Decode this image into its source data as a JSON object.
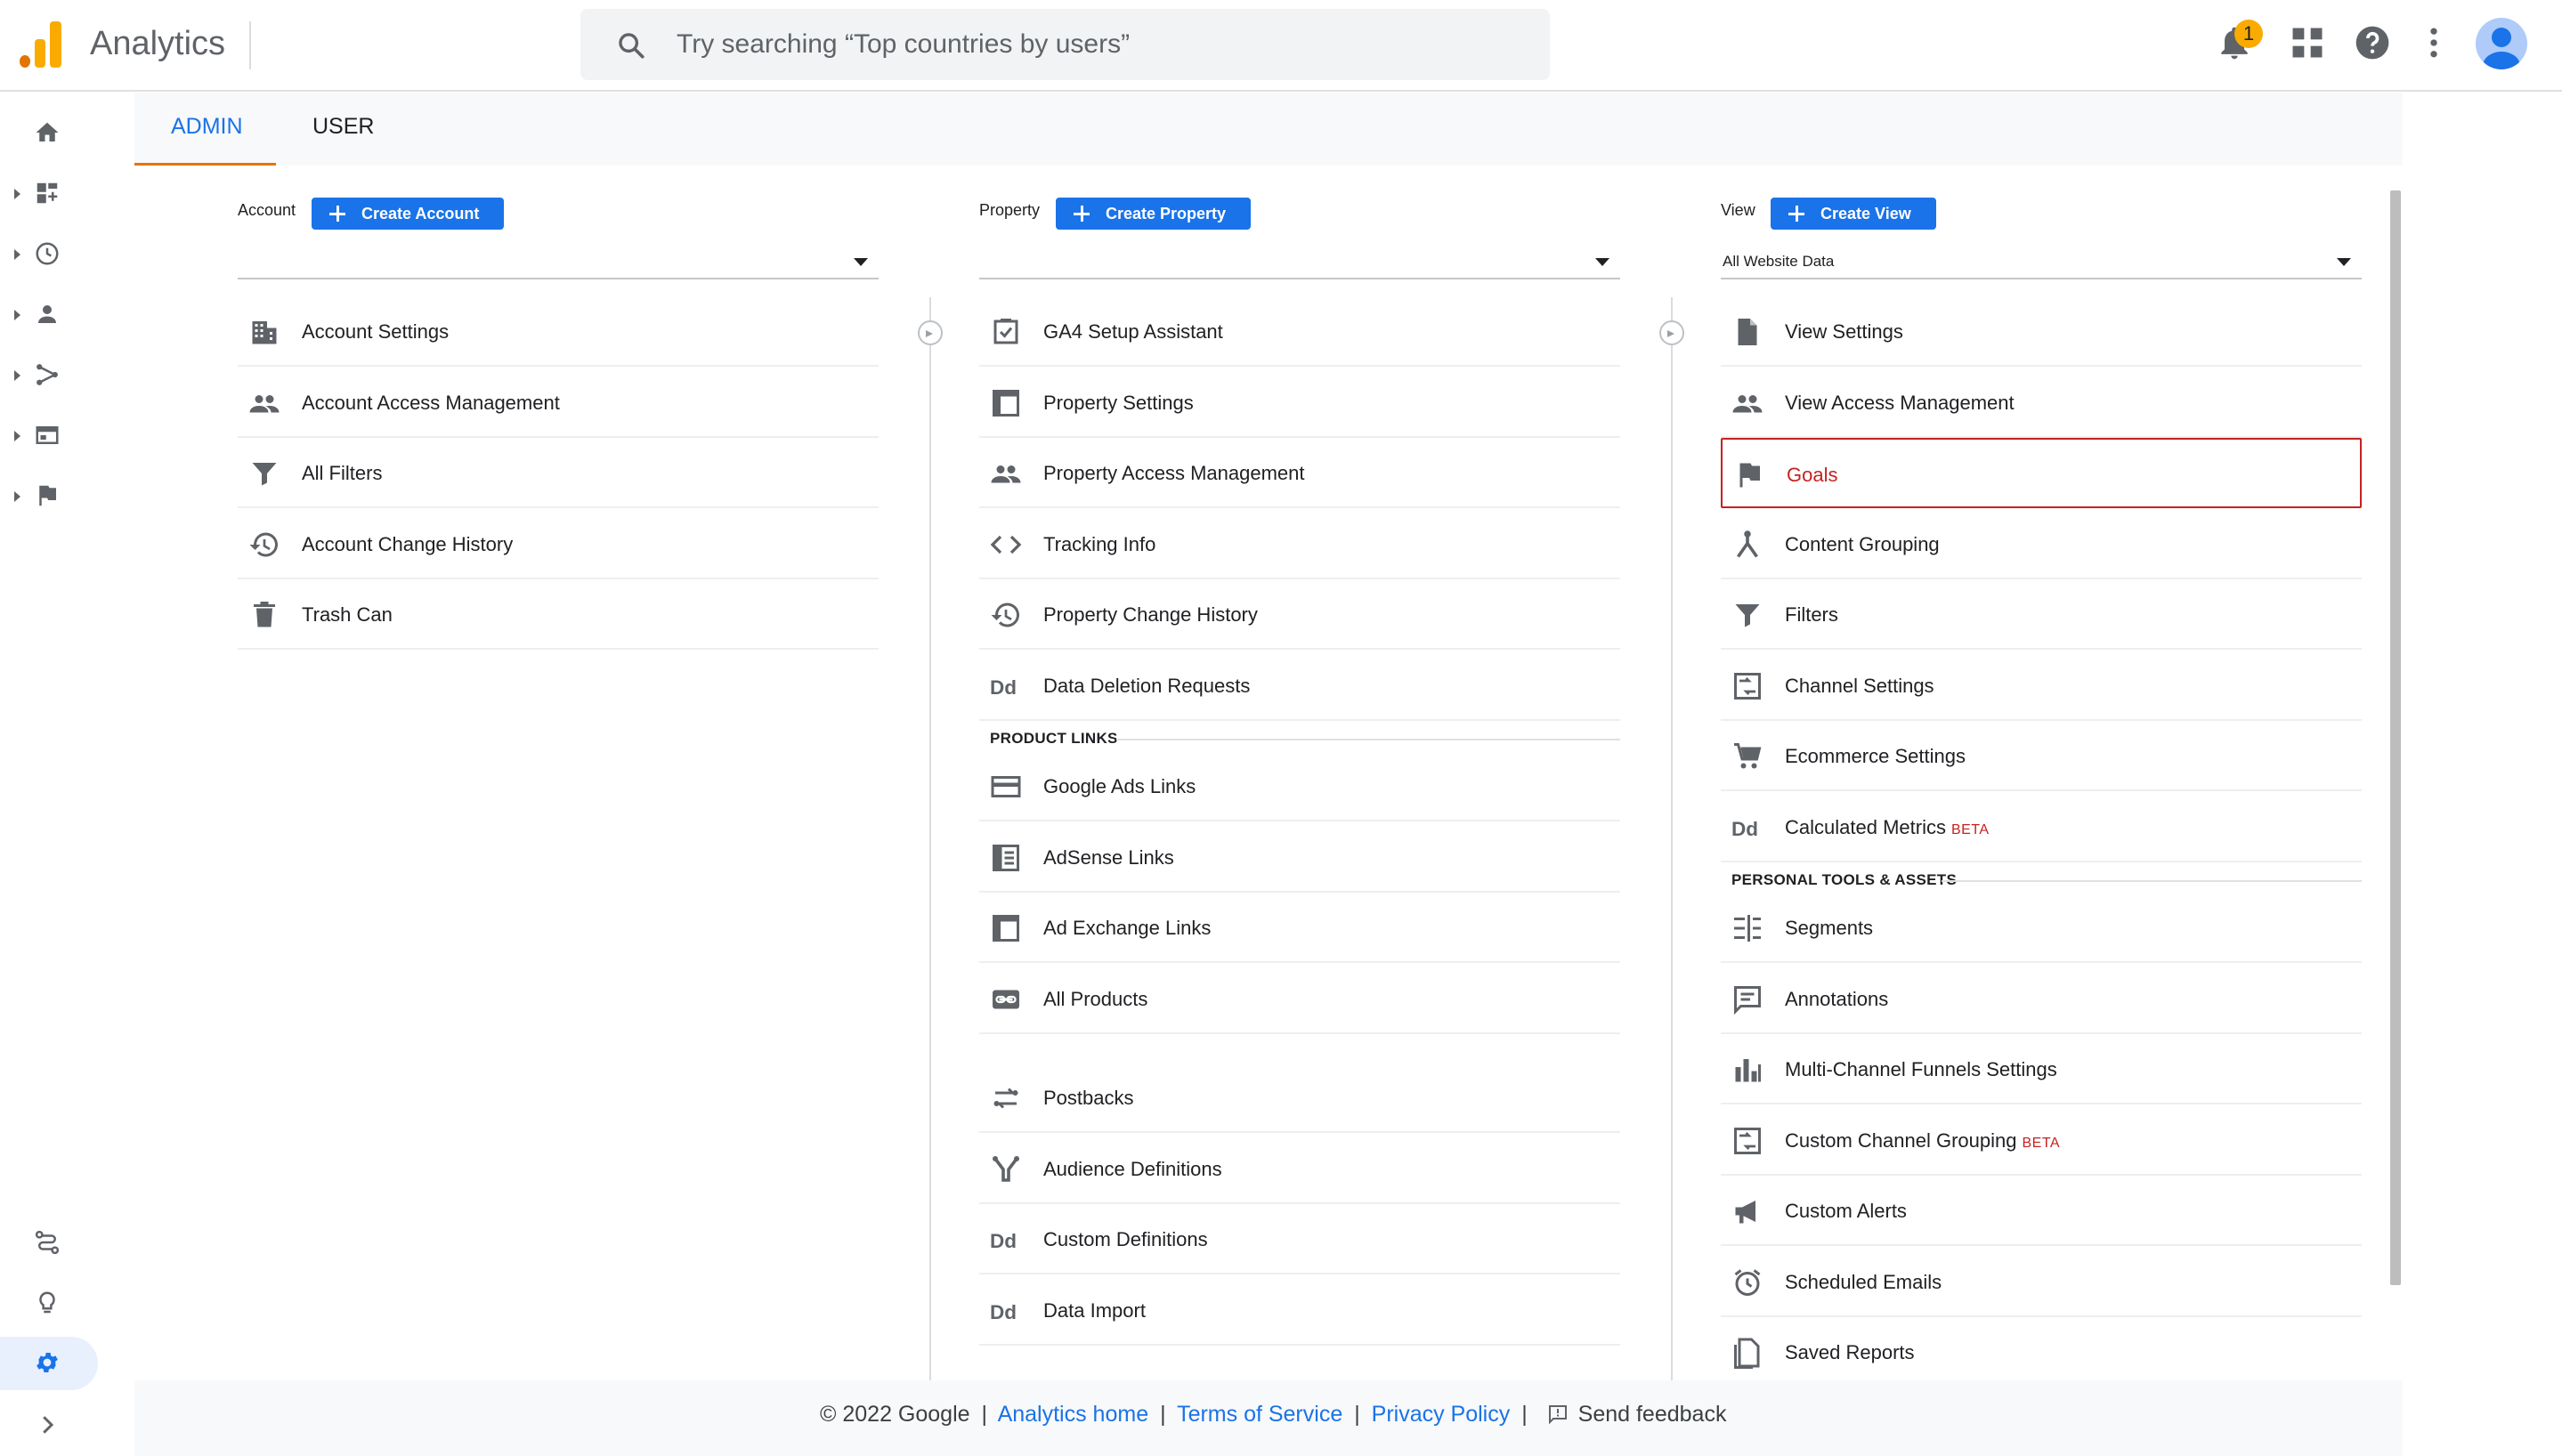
{
  "app": {
    "title": "Analytics"
  },
  "search": {
    "placeholder": "Try searching “Top countries by users”"
  },
  "notifications": {
    "count": "1"
  },
  "tabs": [
    {
      "label": "ADMIN"
    },
    {
      "label": "USER"
    }
  ],
  "account": {
    "label": "Account",
    "create_label": "Create Account",
    "selector_value": "",
    "items": [
      {
        "label": "Account Settings",
        "icon": "building-icon"
      },
      {
        "label": "Account Access Management",
        "icon": "people-icon"
      },
      {
        "label": "All Filters",
        "icon": "filter-icon"
      },
      {
        "label": "Account Change History",
        "icon": "history-icon"
      },
      {
        "label": "Trash Can",
        "icon": "trash-icon"
      }
    ]
  },
  "property": {
    "label": "Property",
    "create_label": "Create Property",
    "selector_value": "",
    "items": [
      {
        "label": "GA4 Setup Assistant",
        "icon": "checkbox-icon"
      },
      {
        "label": "Property Settings",
        "icon": "layout-icon"
      },
      {
        "label": "Property Access Management",
        "icon": "people-icon"
      },
      {
        "label": "Tracking Info",
        "icon": "code-icon"
      },
      {
        "label": "Property Change History",
        "icon": "history-icon"
      },
      {
        "label": "Data Deletion Requests",
        "icon": "dd-icon"
      }
    ],
    "product_links_heading": "PRODUCT LINKS",
    "product_links": [
      {
        "label": "Google Ads Links",
        "icon": "card-icon"
      },
      {
        "label": "AdSense Links",
        "icon": "adsense-icon"
      },
      {
        "label": "Ad Exchange Links",
        "icon": "layout-icon"
      },
      {
        "label": "All Products",
        "icon": "link-icon"
      }
    ],
    "more_items": [
      {
        "label": "Postbacks",
        "icon": "postback-icon"
      },
      {
        "label": "Audience Definitions",
        "icon": "audience-icon"
      },
      {
        "label": "Custom Definitions",
        "icon": "dd-icon"
      },
      {
        "label": "Data Import",
        "icon": "dd-icon"
      }
    ]
  },
  "view": {
    "label": "View",
    "create_label": "Create View",
    "selector_value": "All Website Data",
    "items": [
      {
        "label": "View Settings",
        "icon": "document-icon"
      },
      {
        "label": "View Access Management",
        "icon": "people-icon"
      },
      {
        "label": "Goals",
        "icon": "flag-icon",
        "selected": true
      },
      {
        "label": "Content Grouping",
        "icon": "content-grouping-icon"
      },
      {
        "label": "Filters",
        "icon": "filter-icon"
      },
      {
        "label": "Channel Settings",
        "icon": "channel-icon"
      },
      {
        "label": "Ecommerce Settings",
        "icon": "cart-icon"
      },
      {
        "label": "Calculated Metrics",
        "icon": "dd-icon",
        "badge": "BETA"
      }
    ],
    "personal_heading": "PERSONAL TOOLS & ASSETS",
    "personal_items": [
      {
        "label": "Segments",
        "icon": "segments-icon"
      },
      {
        "label": "Annotations",
        "icon": "comment-icon"
      },
      {
        "label": "Multi-Channel Funnels Settings",
        "icon": "bar-chart-icon"
      },
      {
        "label": "Custom Channel Grouping",
        "icon": "channel-icon",
        "badge": "BETA"
      },
      {
        "label": "Custom Alerts",
        "icon": "megaphone-icon"
      },
      {
        "label": "Scheduled Emails",
        "icon": "alarm-icon"
      },
      {
        "label": "Saved Reports",
        "icon": "saved-report-icon"
      }
    ]
  },
  "footer": {
    "copyright": "© 2022 Google",
    "home_link": "Analytics home",
    "terms_link": "Terms of Service",
    "privacy_link": "Privacy Policy",
    "feedback_label": "Send feedback",
    "separator": "|"
  },
  "colors": {
    "accent": "#1a73e8",
    "tab_underline": "#e37400",
    "selected": "#c5221f",
    "logo": "#f9ab00"
  }
}
